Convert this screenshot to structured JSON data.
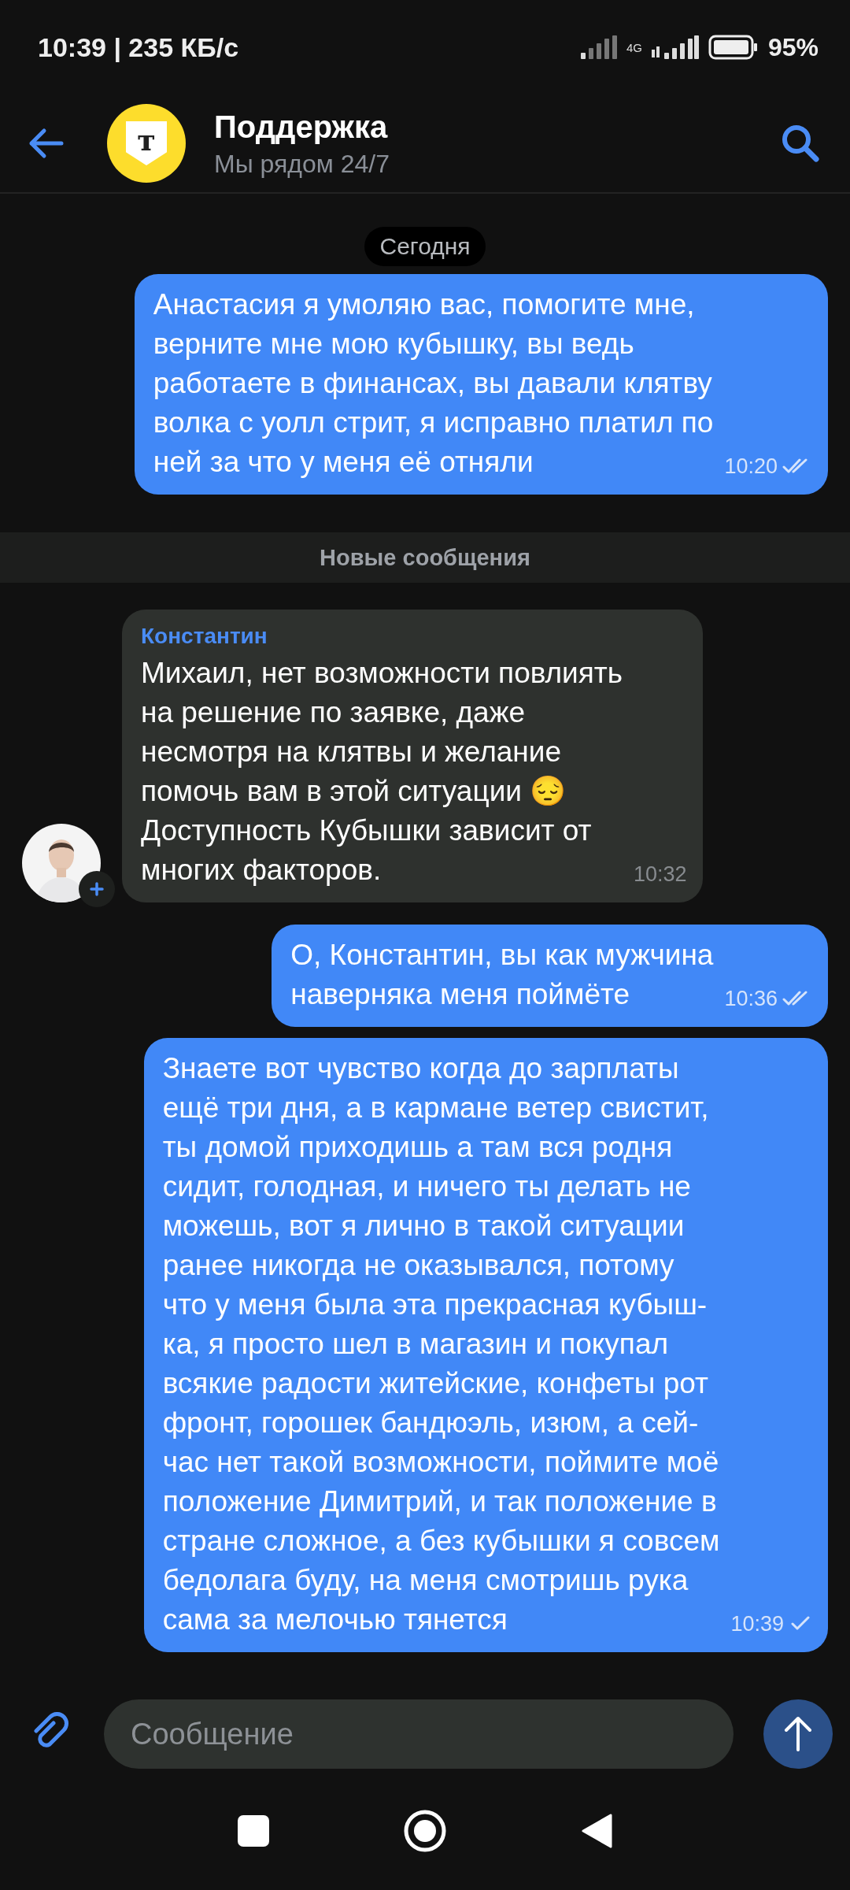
{
  "status_bar": {
    "time_and_speed": "10:39 | 235 КБ/с",
    "network": "4G",
    "battery": "95%"
  },
  "header": {
    "logo_text": "т",
    "title": "Поддержка",
    "subtitle": "Мы рядом 24/7"
  },
  "chat": [
    {
      "kind": "date",
      "text": "Сегодня"
    },
    {
      "kind": "outgoing",
      "text": "Анастасия я умоляю вас, помогите мне,\nверните мне мою кубышку, вы ведь\nработаете в финансах, вы давали клятву\nволка с уолл стрит, я исправно платил по\nней за что у меня её отняли",
      "time": "10:20",
      "read": true
    },
    {
      "kind": "unread",
      "text": "Новые сообщения"
    },
    {
      "kind": "incoming",
      "author": "Константин",
      "text": "Михаил, нет возможности повлиять\nна решение по заявке, даже\nнесмотря на клятвы и желание\nпомочь вам в этой ситуации 😔\nДоступность Кубышки зависит от\nмногих факторов.",
      "time": "10:32"
    },
    {
      "kind": "outgoing",
      "text": "О, Константин, вы как мужчина\nнаверняка меня поймёте",
      "time": "10:36",
      "read": true
    },
    {
      "kind": "outgoing",
      "text": "Знаете вот чувство когда до зарплаты\nещё три дня, а в кармане ветер свистит,\nты домой приходишь а там вся родня\nсидит, голодная, и ничего ты делать не\nможешь, вот я лично в такой ситуации\nранее никогда не оказывался, потому\nчто у меня была эта прекрасная кубыш-\nка, я просто шел в магазин и покупал\nвсякие радости житейские, конфеты рот\nфронт, горошек бандюэль, изюм, а сей-\nчас нет такой возможности, поймите моё\nположение Димитрий, и так положение в\nстране сложное, а без кубышки я совсем\nбедолага буду, на меня смотришь рука\nсама за мелочью тянется",
      "time": "10:39",
      "read": false
    }
  ],
  "composer": {
    "placeholder": "Сообщение"
  }
}
